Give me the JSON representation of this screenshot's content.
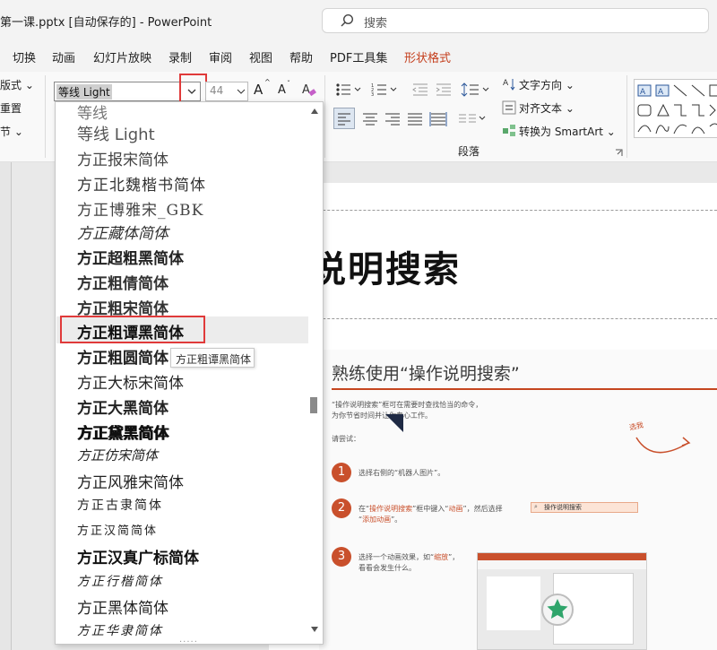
{
  "titlebar": {
    "doc_title": "第一课.pptx [自动保存的]  -  PowerPoint",
    "search_placeholder": "搜索"
  },
  "tabs": [
    "切换",
    "动画",
    "幻灯片放映",
    "录制",
    "审阅",
    "视图",
    "帮助",
    "PDF工具集",
    "形状格式"
  ],
  "active_tab": "形状格式",
  "ribbon": {
    "left_cut": [
      "版式",
      "重置",
      "节"
    ],
    "font_name": "等线 Light",
    "font_size": "44",
    "grow_font": "A",
    "shrink_font": "A",
    "text_direction": "文字方向",
    "align_text": "对齐文本",
    "smartart": "转换为 SmartArt",
    "paragraph_group": "段落"
  },
  "font_list": {
    "items": [
      "等线",
      "等线 Light",
      "方正报宋简体",
      "方正北魏楷书简体",
      "方正博雅宋_GBK",
      "方正藏体简体",
      "方正超粗黑简体",
      "方正粗倩简体",
      "方正粗宋简体",
      "方正粗谭黑简体",
      "方正粗圆简体",
      "方正大标宋简体",
      "方正大黑简体",
      "方正黛黑简体",
      "方正仿宋简体",
      "方正风雅宋简体",
      "方正古隶简体",
      "方正汉简简体",
      "方正汉真广标简体",
      "方正行楷简体",
      "方正黑体简体",
      "方正华隶简体"
    ],
    "highlighted_index": 9,
    "tooltip": "方正粗谭黑简体"
  },
  "slide": {
    "big_title": "说明搜索",
    "tutorial_title": "熟练使用“操作说明搜索”",
    "intro_line1": "“操作说明搜索”框可在需要时查找恰当的命令，",
    "intro_line2": "为你节省时间并让你专心工作。",
    "try_label": "请尝试：",
    "hint": "选我",
    "step1_num": "1",
    "step1": "选择右侧的“机器人图片”。",
    "step2_num": "2",
    "step2_a": "在“",
    "step2_b": "操作说明搜索",
    "step2_c": "”框中键入“",
    "step2_d": "动画",
    "step2_e": "”，然后选择",
    "step2_f": "“",
    "step2_g": "添加动画",
    "step2_h": "”。",
    "mock_search": "操作说明搜索",
    "step3_num": "3",
    "step3_a": "选择一个动画效果，如“",
    "step3_b": "缩放",
    "step3_c": "”，",
    "step3_d": "看看会发生什么。"
  },
  "colors": {
    "accent": "#c43e1c",
    "highlight_box": "#e03a3a",
    "step": "#c9502c"
  }
}
